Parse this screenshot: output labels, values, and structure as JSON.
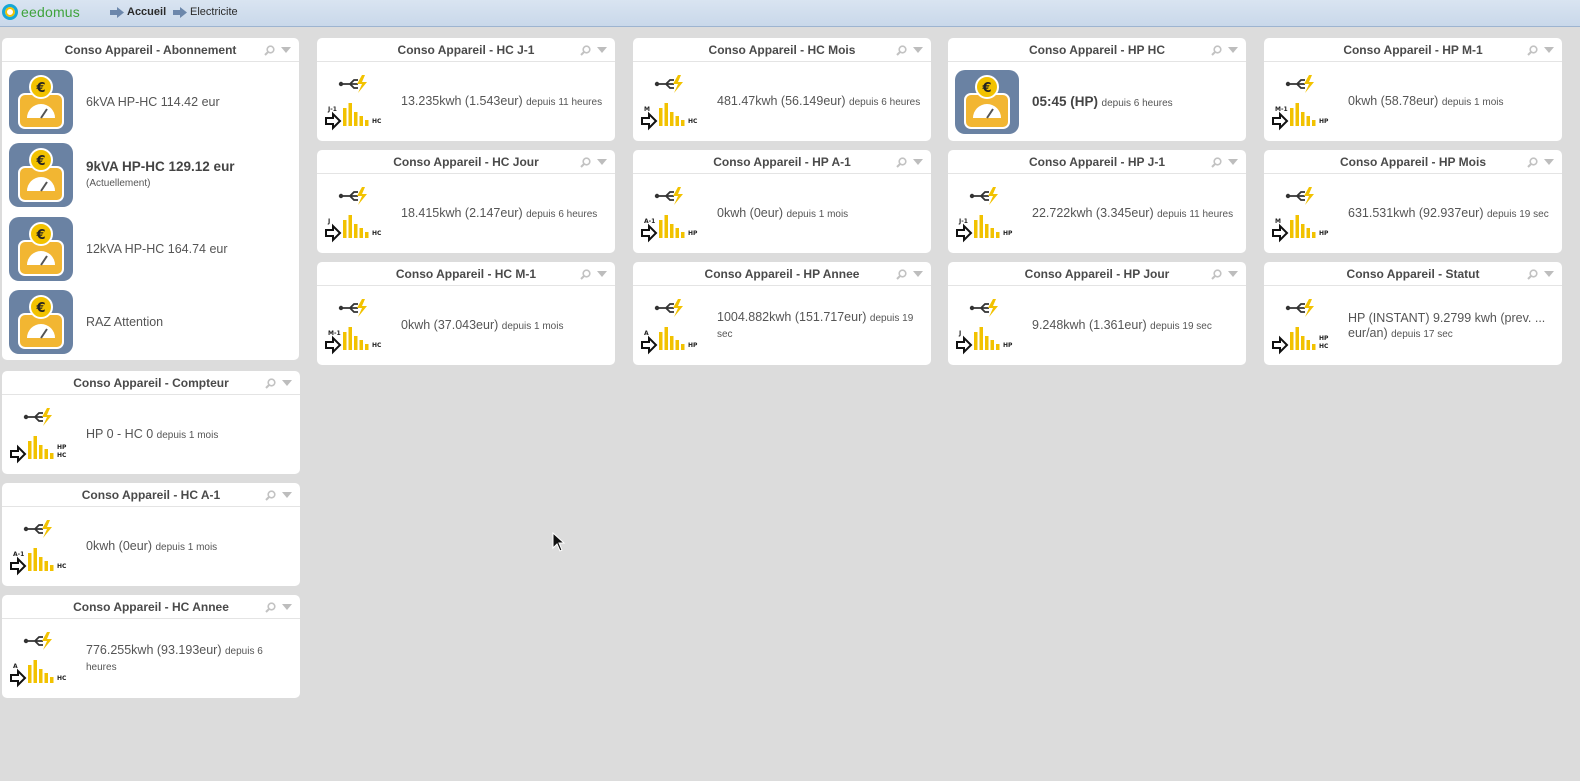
{
  "header": {
    "logo_text": "eedomus",
    "breadcrumb": [
      "Accueil",
      "Electricite"
    ]
  },
  "abonnement": {
    "title": "Conso Appareil - Abonnement",
    "items": [
      {
        "label": "6kVA HP-HC 114.42 eur",
        "sub": ""
      },
      {
        "label": "9kVA HP-HC 129.12 eur",
        "sub": "(Actuellement)"
      },
      {
        "label": "12kVA HP-HC 164.74 eur",
        "sub": ""
      },
      {
        "label": "RAZ Attention",
        "sub": ""
      }
    ]
  },
  "widgets": [
    {
      "title": "Conso Appareil - Compteur",
      "value": "HP 0 - HC 0",
      "since": "depuis 1 mois",
      "icon": "meter-icon",
      "tag": "",
      "mode": "HP HC"
    },
    {
      "title": "Conso Appareil - HC A-1",
      "value": "0kwh (0eur)",
      "since": "depuis 1 mois",
      "icon": "meter-icon",
      "tag": "A-1",
      "mode": "HC"
    },
    {
      "title": "Conso Appareil - HC Annee",
      "value": "776.255kwh (93.193eur)",
      "since": "depuis 6 heures",
      "icon": "meter-icon",
      "tag": "A",
      "mode": "HC"
    },
    {
      "title": "Conso Appareil - HC J-1",
      "value": "13.235kwh (1.543eur)",
      "since": "depuis 11 heures",
      "icon": "meter-icon",
      "tag": "J-1",
      "mode": "HC"
    },
    {
      "title": "Conso Appareil - HC Jour",
      "value": "18.415kwh (2.147eur)",
      "since": "depuis 6 heures",
      "icon": "meter-icon",
      "tag": "J",
      "mode": "HC"
    },
    {
      "title": "Conso Appareil - HC M-1",
      "value": "0kwh (37.043eur)",
      "since": "depuis 1 mois",
      "icon": "meter-icon",
      "tag": "M-1",
      "mode": "HC"
    },
    {
      "title": "Conso Appareil - HC Mois",
      "value": "481.47kwh (56.149eur)",
      "since": "depuis 6 heures",
      "icon": "meter-icon",
      "tag": "M",
      "mode": "HC"
    },
    {
      "title": "Conso Appareil - HP A-1",
      "value": "0kwh (0eur)",
      "since": "depuis 1 mois",
      "icon": "meter-icon",
      "tag": "A-1",
      "mode": "HP"
    },
    {
      "title": "Conso Appareil - HP Annee",
      "value": "1004.882kwh (151.717eur)",
      "since": "depuis 19 sec",
      "icon": "meter-icon",
      "tag": "A",
      "mode": "HP"
    },
    {
      "title": "Conso Appareil - HP HC",
      "value": "05:45 (HP)",
      "since": "depuis 6 heures",
      "icon": "gauge-icon",
      "tag": "",
      "mode": ""
    },
    {
      "title": "Conso Appareil - HP J-1",
      "value": "22.722kwh (3.345eur)",
      "since": "depuis 11 heures",
      "icon": "meter-icon",
      "tag": "J-1",
      "mode": "HP"
    },
    {
      "title": "Conso Appareil - HP Jour",
      "value": "9.248kwh (1.361eur)",
      "since": "depuis 19 sec",
      "icon": "meter-icon",
      "tag": "J",
      "mode": "HP"
    },
    {
      "title": "Conso Appareil - HP M-1",
      "value": "0kwh (58.78eur)",
      "since": "depuis 1 mois",
      "icon": "meter-icon",
      "tag": "M-1",
      "mode": "HP"
    },
    {
      "title": "Conso Appareil - HP Mois",
      "value": "631.531kwh (92.937eur)",
      "since": "depuis 19 sec",
      "icon": "meter-icon",
      "tag": "M",
      "mode": "HP"
    },
    {
      "title": "Conso Appareil - Statut",
      "value": "HP (INSTANT) 9.2799 kwh (prev. ... eur/an)",
      "since": "depuis 17 sec",
      "icon": "meter-icon",
      "tag": "",
      "mode": "HP HC"
    }
  ],
  "colors": {
    "accent": "#f2c200",
    "gauge_bg": "#6a82a3",
    "topbar": "#d0dded"
  }
}
